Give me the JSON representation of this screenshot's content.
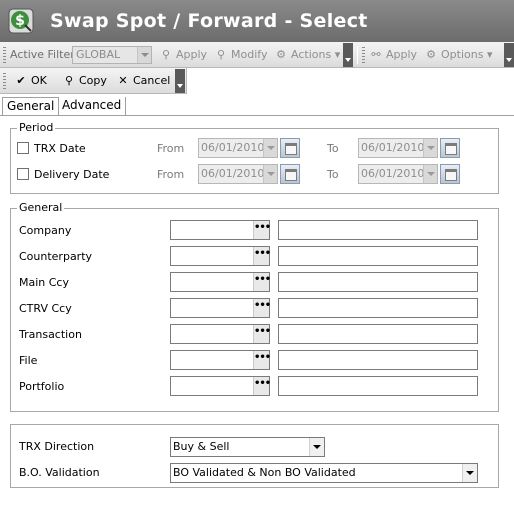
{
  "window": {
    "title": "Swap Spot / Forward - Select",
    "icon": "app-dollar-icon"
  },
  "toolbar": {
    "active_filter_label": "Active Filter",
    "active_filter_value": "GLOBAL",
    "apply_label": "Apply",
    "modify_label": "Modify",
    "actions_label": "Actions",
    "apply2_label": "Apply",
    "options_label": "Options"
  },
  "action_bar": {
    "ok_label": "OK",
    "copy_label": "Copy",
    "cancel_label": "Cancel"
  },
  "tabs": {
    "general": "General",
    "advanced": "Advanced"
  },
  "period": {
    "legend": "Period",
    "from_label": "From",
    "to_label": "To",
    "rows": [
      {
        "label": "TRX Date",
        "from": "06/01/2010",
        "to": "06/01/2010"
      },
      {
        "label": "Delivery Date",
        "from": "06/01/2010",
        "to": "06/01/2010"
      }
    ]
  },
  "general": {
    "legend": "General",
    "fields": [
      {
        "label": "Company"
      },
      {
        "label": "Counterparty"
      },
      {
        "label": "Main Ccy"
      },
      {
        "label": "CTRV Ccy"
      },
      {
        "label": "Transaction"
      },
      {
        "label": "File"
      },
      {
        "label": "Portfolio"
      }
    ]
  },
  "direction": {
    "trx_direction_label": "TRX Direction",
    "trx_direction_value": "Buy & Sell",
    "bo_validation_label": "B.O. Validation",
    "bo_validation_value": "BO Validated & Non BO Validated"
  },
  "colors": {
    "title_bar": "#7a7a7a",
    "toolbar": "#e8e8e8",
    "app_icon_green": "#3d8f3d"
  }
}
